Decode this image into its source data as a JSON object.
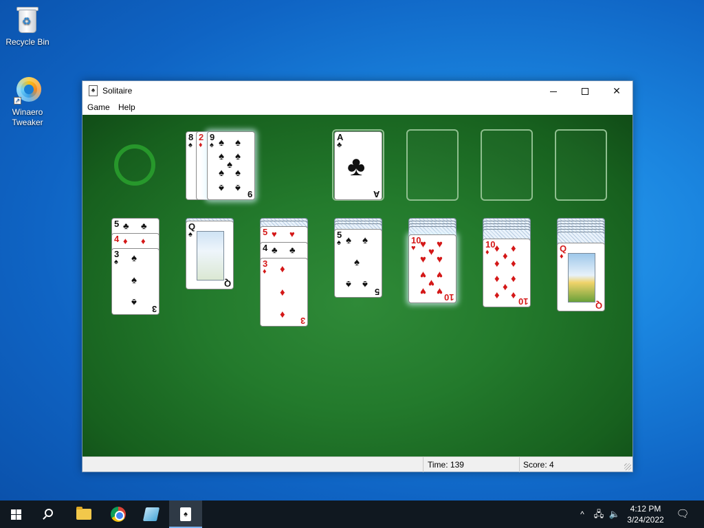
{
  "desktop": {
    "icons": [
      {
        "label": "Recycle Bin"
      },
      {
        "label": "Winaero Tweaker"
      }
    ]
  },
  "window": {
    "title": "Solitaire",
    "menu": [
      "Game",
      "Help"
    ],
    "controls": {
      "minimize": "minimize",
      "maximize": "maximize",
      "close": "✕"
    }
  },
  "game": {
    "stock": {
      "state": "empty-recycle"
    },
    "waste": [
      {
        "rank": "8",
        "suit": "♠",
        "color": "black"
      },
      {
        "rank": "2",
        "suit": "♦",
        "color": "red"
      },
      {
        "rank": "9",
        "suit": "♠",
        "color": "black"
      }
    ],
    "foundations": [
      {
        "rank": "A",
        "suit": "♣",
        "color": "black"
      },
      null,
      null,
      null
    ],
    "tableau": [
      {
        "hidden": 0,
        "cards": [
          {
            "rank": "5",
            "suit": "♣",
            "color": "black"
          },
          {
            "rank": "4",
            "suit": "♦",
            "color": "red"
          },
          {
            "rank": "3",
            "suit": "♠",
            "color": "black"
          }
        ]
      },
      {
        "hidden": 1,
        "cards": [
          {
            "rank": "Q",
            "suit": "♠",
            "color": "black"
          }
        ]
      },
      {
        "hidden": 2,
        "cards": [
          {
            "rank": "5",
            "suit": "♥",
            "color": "red"
          },
          {
            "rank": "4",
            "suit": "♣",
            "color": "black"
          },
          {
            "rank": "3",
            "suit": "♦",
            "color": "red"
          }
        ]
      },
      {
        "hidden": 3,
        "cards": [
          {
            "rank": "5",
            "suit": "♠",
            "color": "black"
          }
        ]
      },
      {
        "hidden": 4,
        "cards": [
          {
            "rank": "10",
            "suit": "♥",
            "color": "red"
          }
        ]
      },
      {
        "hidden": 5,
        "cards": [
          {
            "rank": "10",
            "suit": "♦",
            "color": "red"
          }
        ]
      },
      {
        "hidden": 6,
        "cards": [
          {
            "rank": "Q",
            "suit": "♦",
            "color": "red"
          }
        ]
      }
    ]
  },
  "status": {
    "time_label": "Time:",
    "time_value": "139",
    "score_label": "Score:",
    "score_value": "4"
  },
  "taskbar": {
    "pinned": [
      "start-icon",
      "search-icon",
      "file-explorer-icon",
      "chrome-icon",
      "winaero-tweaker-icon",
      "solitaire-icon"
    ],
    "tray_chevron": "^",
    "clock_time": "4:12 PM",
    "clock_date": "3/24/2022"
  }
}
